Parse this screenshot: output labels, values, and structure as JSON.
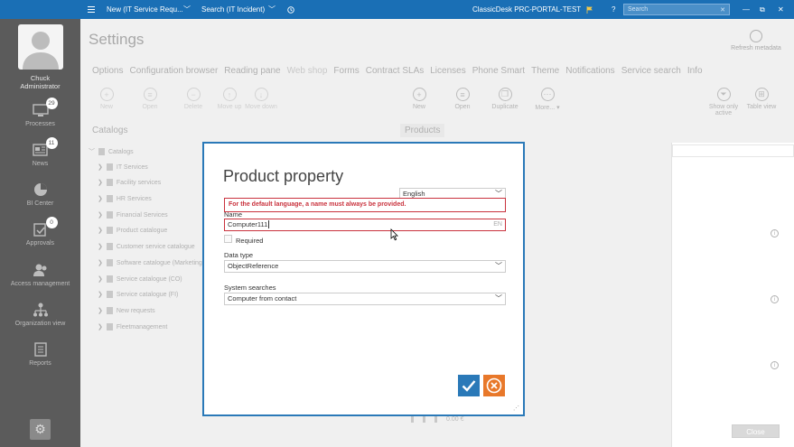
{
  "topbar": {
    "menu_icon": "hamburger-icon",
    "tab1": "New (IT Service Requ...",
    "tab2": "Search (IT Incident)",
    "app_title": "ClassicDesk PRC-PORTAL-TEST",
    "search_placeholder": "Search",
    "accent": "#1a6fb5"
  },
  "leftnav": {
    "user_first": "Chuck",
    "user_last": "Administrator",
    "items": [
      {
        "label": "Processes",
        "badge": "29",
        "icon": "processes-icon"
      },
      {
        "label": "News",
        "badge": "11",
        "icon": "news-icon"
      },
      {
        "label": "BI Center",
        "badge": "",
        "icon": "pie-chart-icon"
      },
      {
        "label": "Approvals",
        "badge": "0",
        "icon": "approvals-icon"
      },
      {
        "label": "Access management",
        "badge": "",
        "icon": "access-icon"
      },
      {
        "label": "Organization view",
        "badge": "",
        "icon": "org-icon"
      },
      {
        "label": "Reports",
        "badge": "",
        "icon": "reports-icon"
      }
    ]
  },
  "settings": {
    "title": "Settings",
    "refresh": "Refresh metadata",
    "tabs": [
      "Options",
      "Configuration browser",
      "Reading pane",
      "Web shop",
      "Forms",
      "Contract SLAs",
      "Licenses",
      "Phone Smart",
      "Theme",
      "Notifications",
      "Service search",
      "Info"
    ],
    "left_toolbar": [
      "New",
      "Open",
      "Delete",
      "Move up",
      "Move down"
    ],
    "right_toolbar": [
      "New",
      "Open",
      "Duplicate",
      "More..."
    ],
    "far_toolbar": [
      "Show only active",
      "Table view"
    ],
    "catalogs_label": "Catalogs",
    "products_label": "Products",
    "tree_root": "Catalogs",
    "tree_items": [
      "IT Services",
      "Facility services",
      "HR Services",
      "Financial Services",
      "Product catalogue",
      "Customer service catalogue",
      "Software catalogue (Marketing)",
      "Service catalogue (CO)",
      "Service catalogue (FI)",
      "New requests",
      "Fleetmanagement"
    ],
    "footer_value": "0.00 €",
    "close_label": "Close"
  },
  "dialog": {
    "title": "Product property",
    "language": "English",
    "error": "For the default language, a name must always be provided.",
    "name_label": "Name",
    "name_value": "Computer111",
    "name_suffix": "EN",
    "required_label": "Required",
    "datatype_label": "Data type",
    "datatype_value": "ObjectReference",
    "systemsearch_label": "System searches",
    "systemsearch_value": "Computer from contact",
    "ok_color": "#2a79b8",
    "cancel_color": "#e8782a",
    "error_color": "#c9323d"
  }
}
